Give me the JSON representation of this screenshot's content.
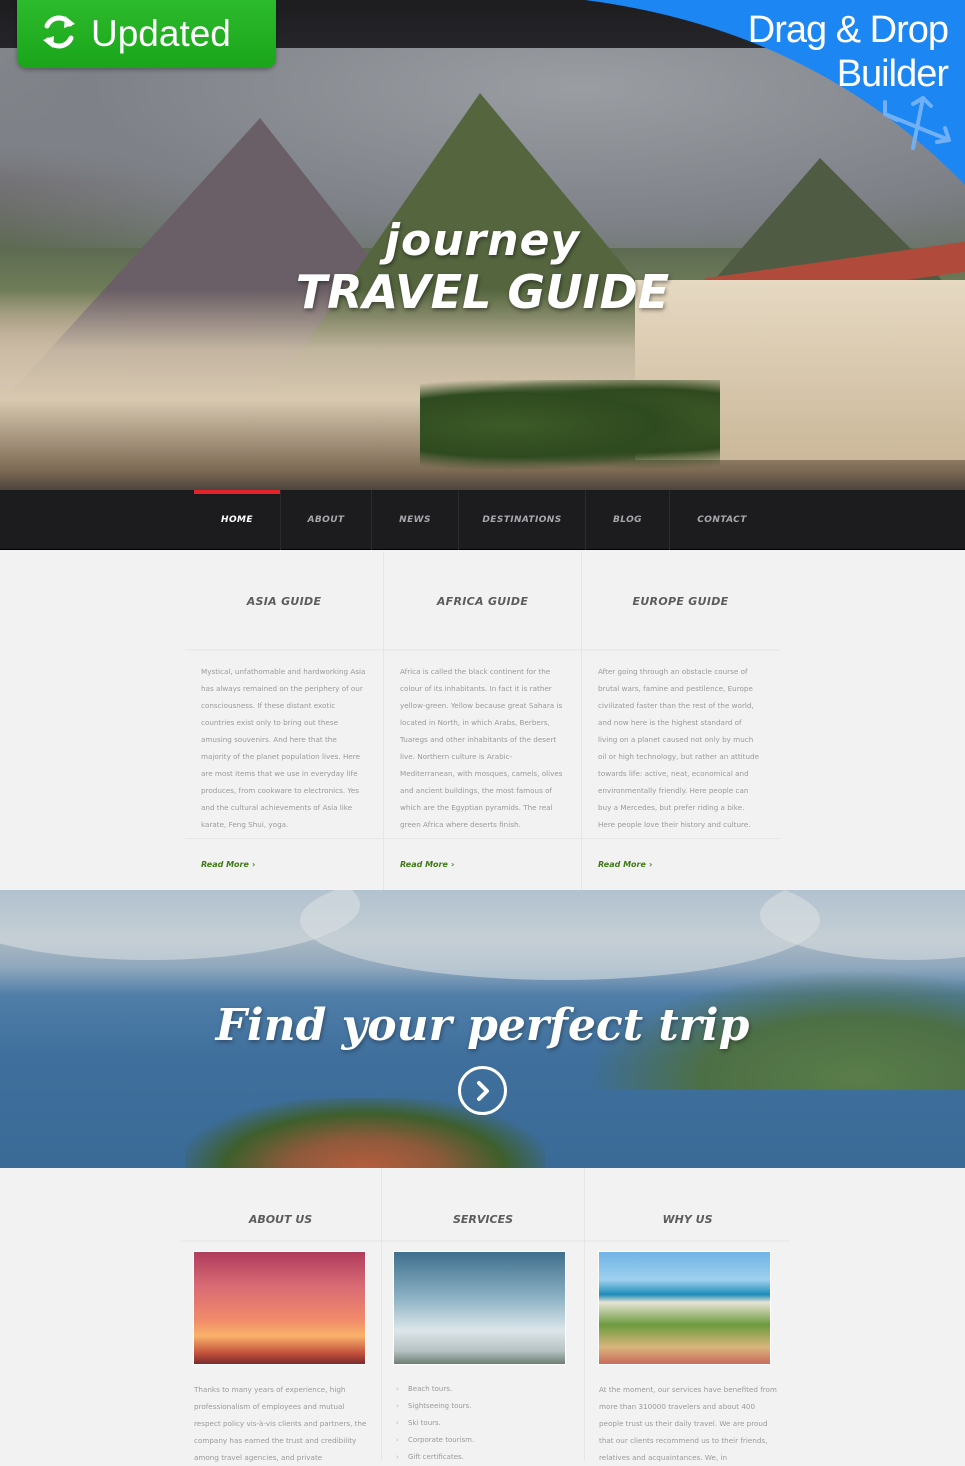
{
  "badges": {
    "updated_label": "Updated",
    "updated_icon": "refresh-icon",
    "corner_line1": "Drag & Drop",
    "corner_line2": "Builder",
    "corner_icon": "move-arrows-icon",
    "colors": {
      "updated_green": "#1fae1f",
      "builder_blue": "#1c86f2"
    }
  },
  "hero": {
    "subtitle": "journey",
    "title": "TRAVEL GUIDE"
  },
  "nav": {
    "accent_color": "#e3222a",
    "items": [
      {
        "label": "HOME",
        "active": true
      },
      {
        "label": "ABOUT",
        "active": false
      },
      {
        "label": "NEWS",
        "active": false
      },
      {
        "label": "DESTINATIONS",
        "active": false
      },
      {
        "label": "BLOG",
        "active": false
      },
      {
        "label": "CONTACT",
        "active": false
      }
    ]
  },
  "guides": [
    {
      "title": "ASIA GUIDE",
      "text": "Mystical, unfathomable and hardworking Asia has always remained on the periphery of our  consciousness. If these distant exotic countries exist only to bring out these amusing souvenirs. And  here that the majority of the planet population lives. Here are most items that we use in everyday life produces, from cookware to electronics. Yes and the cultural achievements of Asia like karate, Feng Shui, yoga.",
      "link": "Read More"
    },
    {
      "title": "AFRICA GUIDE",
      "text": "Africa is called the black continent for the colour of its inhabitants. In fact it is rather yellow-green. Yellow because great Sahara is located in North, in which Arabs, Berbers, Tuaregs and other inhabitants of the desert live. Northern culture is Arabic-Mediterranean, with mosques, camels, olives and ancient buildings, the most famous of which are the Egyptian pyramids. The real green Africa where deserts finish.",
      "link": "Read More"
    },
    {
      "title": "EUROPE GUIDE",
      "text": "After going through an obstacle course of brutal wars, famine and pestilence, Europe civilizated faster than the rest of the world, and now here is the highest standard of living on a planet caused not only by much oil or high technology, but rather an attitude towards life: active, neat, economical and environmentally friendly. Here people can buy a Mercedes, but prefer riding a bike. Here people love their history and culture.",
      "link": "Read More"
    }
  ],
  "banner": {
    "title": "Find your perfect trip",
    "button_icon": "chevron-right-circle-icon"
  },
  "bottom": {
    "about": {
      "title": "ABOUT US",
      "image": "sunset-palm-image",
      "text": "Thanks to many years of experience, high professionalism of employees and mutual respect policy vis-à-vis clients and partners, the company has earned the trust and credibility among travel agencies, and private"
    },
    "services": {
      "title": "SERVICES",
      "image": "airplane-image",
      "items": [
        "Beach tours.",
        "Sightseeing tours.",
        "Ski tours.",
        "Corporate tourism.",
        "Gift certificates."
      ]
    },
    "why": {
      "title": "WHY US",
      "image": "resort-hotel-image",
      "text": "At the moment, our services have benefited from more than 310000  travelers and about 400 people trust us their daily travel. We are proud that our clients recommend us to their friends, relatives and acquaintances. We, in"
    }
  }
}
